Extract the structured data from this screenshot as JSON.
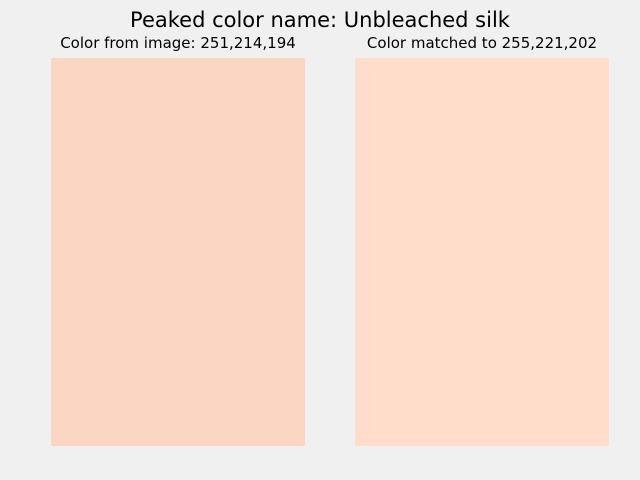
{
  "title": "Peaked color name: Unbleached silk",
  "panels": [
    {
      "title": "Color from image: 251,214,194",
      "color": "#fbd6c2"
    },
    {
      "title": "Color matched to 255,221,202",
      "color": "#ffddca"
    }
  ],
  "background_color": "#f0f0f0"
}
